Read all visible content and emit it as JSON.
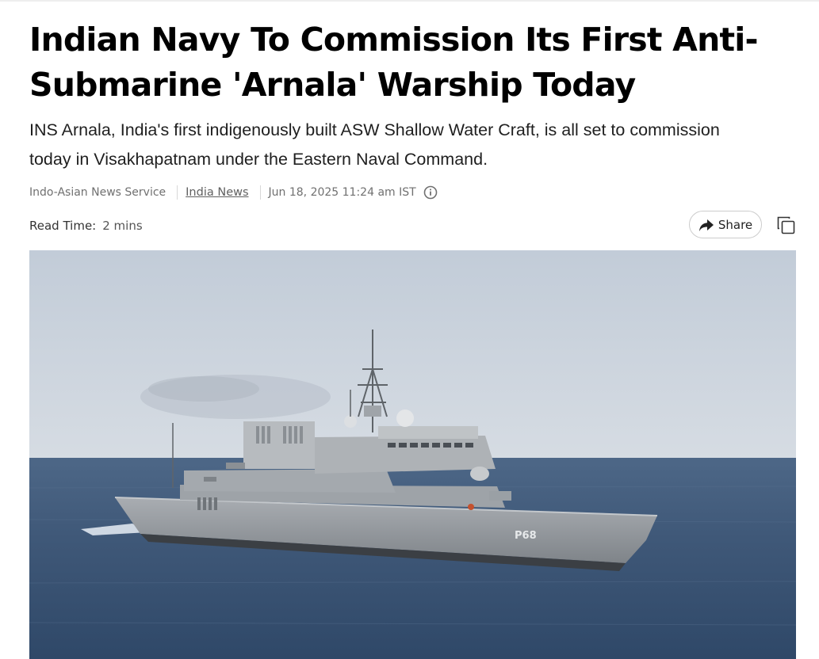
{
  "article": {
    "headline": "Indian Navy To Commission Its First Anti-Submarine 'Arnala' Warship Today",
    "summary": "INS Arnala, India's first indigenously built ASW Shallow Water Craft, is all set to commission today in Visakhapatnam under the Eastern Naval Command.",
    "source": "Indo-Asian News Service",
    "category": "India News",
    "timestamp": "Jun 18, 2025 11:24 am IST",
    "read_time_label": "Read Time:",
    "read_time_value": "2 mins",
    "share_label": "Share"
  },
  "hero_image": {
    "ship_hull_marking": "P68"
  },
  "icons": {
    "info": "info-circle-icon",
    "share": "share-arrow-icon",
    "copy": "copy-icon"
  },
  "colors": {
    "text_primary": "#000000",
    "text_meta": "#707070",
    "sea": "#3f5a7c",
    "sky": "#c9d2dd"
  }
}
